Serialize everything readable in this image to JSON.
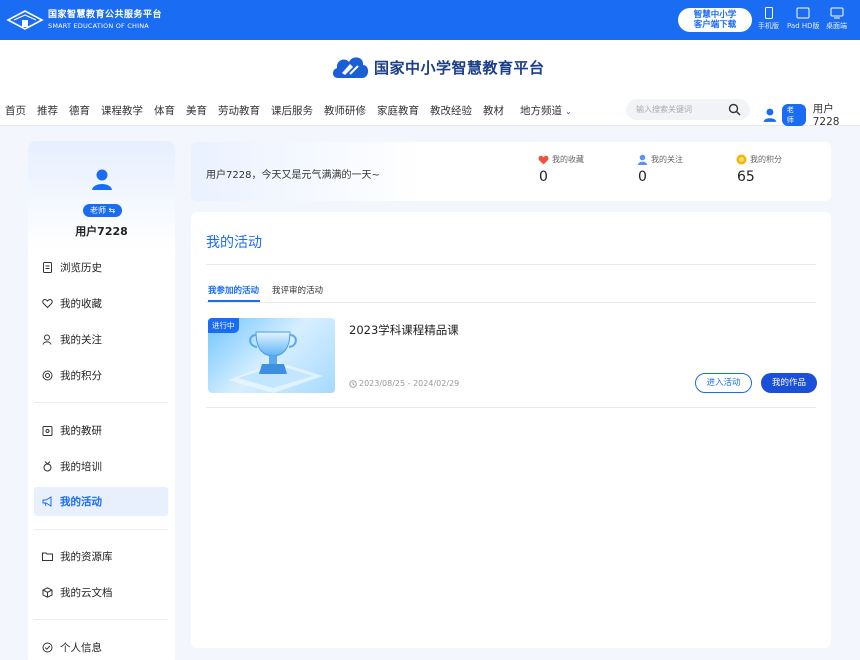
{
  "topbar": {
    "brand_cn": "国家智慧教育公共服务平台",
    "brand_en": "SMART EDUCATION OF CHINA",
    "download_line1": "智慧中小学",
    "download_line2": "客户端下载",
    "devices": [
      "手机版",
      "Pad HD版",
      "桌面端"
    ]
  },
  "header": {
    "site_title": "国家中小学智慧教育平台",
    "nav": [
      "首页",
      "推荐",
      "德育",
      "课程教学",
      "体育",
      "美育",
      "劳动教育",
      "课后服务",
      "教师研修",
      "家庭教育",
      "教改经验",
      "教材",
      "地方频道"
    ],
    "search_placeholder": "输入搜索关键词",
    "user_badge": "老师",
    "user_name": "用户7228"
  },
  "left": {
    "badge": "老师 ⇆",
    "user_name": "用户7228",
    "menu": [
      "浏览历史",
      "我的收藏",
      "我的关注",
      "我的积分",
      "我的教研",
      "我的培训",
      "我的活动",
      "我的资源库",
      "我的云文档",
      "个人信息"
    ],
    "active_index": 6
  },
  "greeting": {
    "text": "用户7228，今天又是元气满满的一天~",
    "stats": [
      {
        "label": "我的收藏",
        "value": "0"
      },
      {
        "label": "我的关注",
        "value": "0"
      },
      {
        "label": "我的积分",
        "value": "65"
      }
    ]
  },
  "main": {
    "title": "我的活动",
    "tabs": [
      "我参加的活动",
      "我评审的活动"
    ],
    "activity": {
      "status": "进行中",
      "title": "2023学科课程精品课",
      "date": "2023/08/25 - 2024/02/29",
      "enter_label": "进入活动",
      "works_label": "我的作品"
    }
  },
  "colors": {
    "accent": "#1a6cf2",
    "dark_blue": "#1a4fd8"
  }
}
